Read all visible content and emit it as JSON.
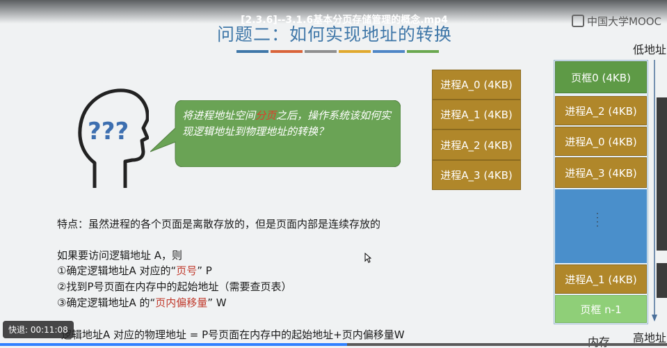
{
  "video": {
    "title": "[2.3.6]--3.1.6基本分页存储管理的概念.mp4",
    "speed_label": "快退: 00:11:08",
    "progress": 0.52
  },
  "logo": {
    "text": "中国大学MOOC"
  },
  "slide": {
    "title": "问题二：如何实现地址的转换",
    "stripe_colors": [
      "#3f77a8",
      "#d9643a",
      "#8f8f8f",
      "#e0a92e",
      "#4f86c6",
      "#6aa84f"
    ],
    "bubble": {
      "part1": "将进程地址空间",
      "highlight": "分页",
      "part2": "之后，操作系统该如何实现逻辑地址到物理地址的转换？"
    },
    "pages": [
      "进程A_0 (4KB)",
      "进程A_1 (4KB)",
      "进程A_2 (4KB)",
      "进程A_3 (4KB)"
    ],
    "feature": "特点：虽然进程的各个页面是离散存放的，但是页面内部是连续存放的",
    "steps_intro": "如果要访问逻辑地址 A，则",
    "step1": {
      "pre": "①确定逻辑地址A 对应的“",
      "hl": "页号",
      "post": "” P"
    },
    "step2": "②找到P号页面在内存中的起始地址（需要查页表）",
    "step3": {
      "pre": "③确定逻辑地址A 的“",
      "hl": "页内偏移量",
      "post": "” W"
    },
    "formula": "逻辑地址A 对应的物理地址 = P号页面在内存中的起始地址+页内偏移量W"
  },
  "memory": {
    "frames": [
      "页框0 (4KB)",
      "进程A_2 (4KB)",
      "进程A_0 (4KB)",
      "进程A_3 (4KB)",
      "进程A_1 (4KB)",
      "页框 n-1"
    ],
    "low_label": "低地址",
    "high_label": "高地址",
    "label": "内存"
  }
}
